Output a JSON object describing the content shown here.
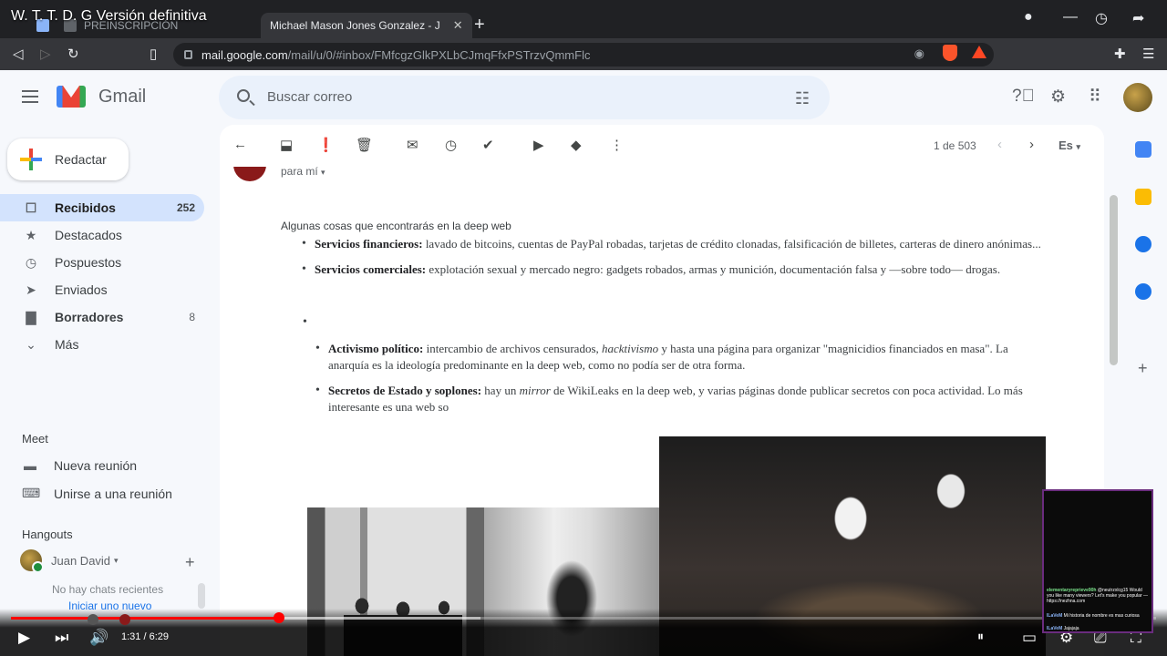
{
  "video": {
    "title": "W. T. T. D. G Versión definitiva",
    "time_current": "1:31",
    "time_total": "6:29",
    "time_text": "1:31 / 6:29",
    "progress_fraction": 0.234
  },
  "browser": {
    "tabs": [
      {
        "label": "PREINSCRIPCIÓN"
      },
      {
        "label": "Michael Mason Jones Gonzalez - J"
      }
    ],
    "url_host": "mail.google.com",
    "url_path": "/mail/u/0/#inbox/FMfcgzGlkPXLbCJmqFfxPSTrzvQmmFlc",
    "new_tab_symbol": "+",
    "close_symbol": "✕"
  },
  "gmail": {
    "brand": "Gmail",
    "search_placeholder": "Buscar correo",
    "compose_label": "Redactar",
    "nav": [
      {
        "label": "Recibidos",
        "count": "252",
        "icon": "inbox-icon",
        "glyph": "☐"
      },
      {
        "label": "Destacados",
        "count": "",
        "icon": "star-icon",
        "glyph": "★"
      },
      {
        "label": "Pospuestos",
        "count": "",
        "icon": "clock-icon",
        "glyph": "◷"
      },
      {
        "label": "Enviados",
        "count": "",
        "icon": "send-icon",
        "glyph": "➤"
      },
      {
        "label": "Borradores",
        "count": "8",
        "icon": "draft-icon",
        "glyph": "▇"
      },
      {
        "label": "Más",
        "count": "",
        "icon": "chevron-down-icon",
        "glyph": "⌄"
      }
    ],
    "meet": {
      "heading": "Meet",
      "new_meeting": "Nueva reunión",
      "join_meeting": "Unirse a una reunión"
    },
    "hangouts": {
      "heading": "Hangouts",
      "user": "Juan David",
      "no_chats": "No hay chats recientes",
      "start_new": "Iniciar uno nuevo"
    },
    "pager": "1 de 503",
    "language": "Es",
    "recipient": "para mí",
    "email": {
      "intro": "Algunas cosas que encontrarás en la deep web",
      "item1_label": "Servicios financieros:",
      "item1_text": " lavado de bitcoins, cuentas de PayPal robadas, tarjetas de crédito clonadas, falsificación de billetes, carteras de dinero anónimas...",
      "item2_label": "Servicios comerciales:",
      "item2_text": " explotación sexual y mercado negro: gadgets robados, armas y munición, documentación falsa y —sobre todo— drogas.",
      "item3_label": "Activismo político:",
      "item3_text_a": " intercambio de archivos censurados, ",
      "item3_italic": "hacktivismo",
      "item3_text_b": " y hasta una página para organizar \"magnicidios financiados en masa\". La anarquía es la ideología predominante en la deep web, como no podía ser de otra forma.",
      "item4_label": "Secretos de Estado y soplones:",
      "item4_text_a": " hay un ",
      "item4_italic": "mirror",
      "item4_text_b": " de WikiLeaks en la deep web, y varias páginas donde publicar secretos con poca actividad. Lo más interesante es una web so"
    }
  },
  "chat_overlay": [
    {
      "user": "elementaryreprieve90h",
      "msg": " @neutrzxlcg15 Would you like many viewers? Let's make you popular — https://nezhna.com"
    },
    {
      "user": "ILaVeM",
      "msg": " Mi historia de nombre es mas curiosa"
    },
    {
      "user": "ILaVeM",
      "msg": " Jajajaja"
    }
  ],
  "colors": {
    "gmail_accent": "#d3e3fd",
    "youtube_red": "#ff0000",
    "chrome_dark": "#202124"
  }
}
